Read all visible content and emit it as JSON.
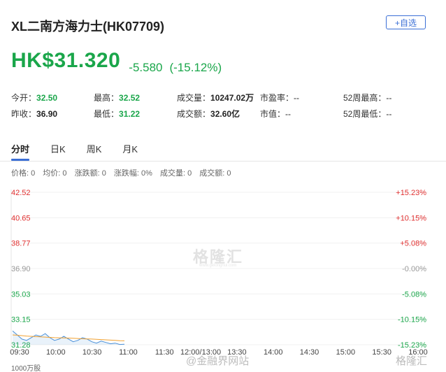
{
  "header": {
    "title": "XL二南方海力士(HK07709)",
    "fav_label": "+自选"
  },
  "quote": {
    "price": "HK$31.320",
    "change": "-5.580",
    "change_pct": "(-15.12%)"
  },
  "stats": {
    "open_label": "今开：",
    "open": "32.50",
    "high_label": "最高：",
    "high": "32.52",
    "volume_label": "成交量：",
    "volume": "10247.02万",
    "pe_label": "市盈率：",
    "pe": "--",
    "w52_high_label": "52周最高：",
    "w52_high": "--",
    "prev_close_label": "昨收：",
    "prev_close": "36.90",
    "low_label": "最低：",
    "low": "31.22",
    "turnover_label": "成交额：",
    "turnover": "32.60亿",
    "mcap_label": "市值：",
    "mcap": "--",
    "w52_low_label": "52周最低：",
    "w52_low": "--"
  },
  "tabs": [
    "分时",
    "日K",
    "周K",
    "月K"
  ],
  "info_bar": [
    "价格: 0",
    "均价: 0",
    "涨跌额: 0",
    "涨跌幅: 0%",
    "成交量: 0",
    "成交额: 0"
  ],
  "watermark": {
    "main": "格隆汇",
    "sub": "www.gelonghui.com"
  },
  "footer": {
    "weibo": "@金融界网站",
    "logo": "格隆汇"
  },
  "colors": {
    "up": "#e03030",
    "down": "#1aa64a",
    "neutral": "#999999",
    "accent": "#3b6fd6",
    "price_line": "#4a90d9",
    "avg_line": "#f0a030"
  },
  "chart_data": {
    "type": "line",
    "y_left_ticks": [
      "42.52",
      "40.65",
      "38.77",
      "36.90",
      "35.03",
      "33.15",
      "31.28"
    ],
    "y_right_ticks": [
      "+15.23%",
      "+10.15%",
      "+5.08%",
      "-0.00%",
      "-5.08%",
      "-10.15%",
      "-15.23%"
    ],
    "x_ticks": [
      "09:30",
      "10:00",
      "10:30",
      "11:00",
      "11:30",
      "12:00/13:00",
      "13:30",
      "14:00",
      "14:30",
      "15:00",
      "15:30",
      "16:00"
    ],
    "ylim": [
      31.28,
      42.52
    ],
    "unit_label": "1000万股",
    "series": [
      {
        "values": [
          32.3,
          32.0,
          31.7,
          31.6,
          31.8,
          32.0,
          31.9,
          32.1,
          31.8,
          31.6,
          31.7,
          31.9,
          31.7,
          31.5,
          31.6,
          31.8,
          31.7,
          31.5,
          31.4,
          31.55,
          31.45,
          31.35,
          31.4,
          31.3,
          31.32
        ]
      },
      {
        "values": [
          32.0,
          31.98,
          31.95,
          31.92,
          31.9,
          31.88,
          31.86,
          31.84,
          31.82,
          31.8,
          31.79,
          31.78,
          31.77,
          31.76,
          31.74,
          31.72,
          31.71,
          31.7,
          31.68,
          31.66,
          31.64,
          31.62,
          31.6,
          31.58,
          31.57
        ]
      }
    ]
  }
}
